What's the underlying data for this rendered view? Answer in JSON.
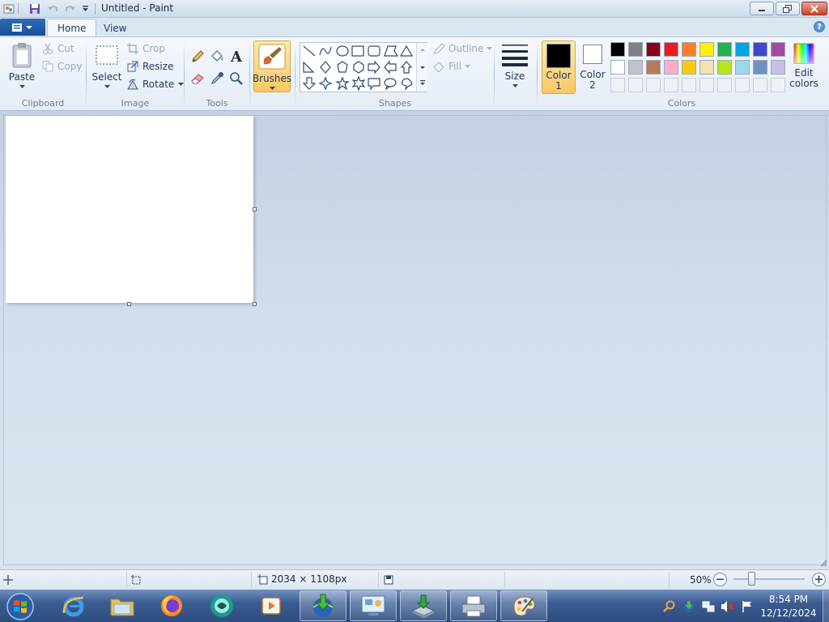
{
  "window": {
    "title": "Untitled - Paint"
  },
  "tabs": {
    "home": "Home",
    "view": "View"
  },
  "ribbon": {
    "clipboard": {
      "label": "Clipboard",
      "paste": "Paste",
      "cut": "Cut",
      "copy": "Copy"
    },
    "image": {
      "label": "Image",
      "select": "Select",
      "crop": "Crop",
      "resize": "Resize",
      "rotate": "Rotate"
    },
    "tools": {
      "label": "Tools"
    },
    "brushes": "Brushes",
    "shapes": {
      "label": "Shapes",
      "outline": "Outline",
      "fill": "Fill"
    },
    "size": "Size",
    "colors": {
      "label": "Colors",
      "color1": "Color",
      "color1_num": "1",
      "color2": "Color",
      "color2_num": "2",
      "edit": "Edit",
      "edit2": "colors",
      "color1_value": "#000000",
      "color2_value": "#ffffff",
      "palette_row1": [
        "#000000",
        "#7f7f7f",
        "#880015",
        "#ed1c24",
        "#ff7f27",
        "#fff200",
        "#22b14c",
        "#00a2e8",
        "#3f48cc",
        "#a349a4"
      ],
      "palette_row2": [
        "#ffffff",
        "#c3c3c3",
        "#b97a57",
        "#ffaec9",
        "#ffc90e",
        "#efe4b0",
        "#b5e61d",
        "#99d9ea",
        "#7092be",
        "#c8bfe7"
      ]
    }
  },
  "status": {
    "dimensions": "2034 × 1108px",
    "zoom": "50%"
  },
  "taskbar": {
    "time": "8:54 PM",
    "date": "12/12/2024"
  }
}
